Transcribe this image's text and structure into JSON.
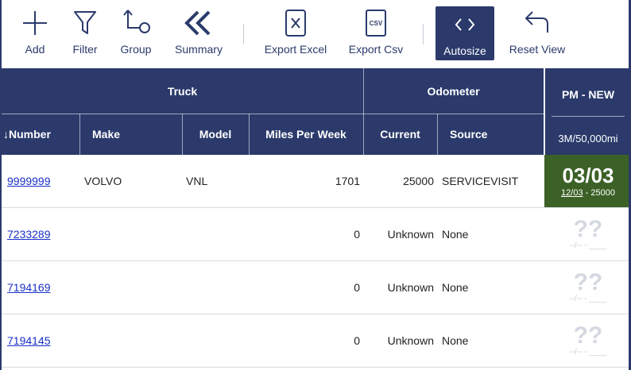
{
  "toolbar": {
    "add": "Add",
    "filter": "Filter",
    "group": "Group",
    "summary": "Summary",
    "export_excel": "Export Excel",
    "export_csv": "Export Csv",
    "export_csv_icon_text": "CSV",
    "autosize": "Autosize",
    "reset_view": "Reset View"
  },
  "headers": {
    "group_truck": "Truck",
    "group_odometer": "Odometer",
    "group_pm": "PM - NEW",
    "pm_sub": "3M/50,000mi",
    "number": "↓Number",
    "make": "Make",
    "model": "Model",
    "miles_per_week": "Miles Per Week",
    "current": "Current",
    "source": "Source"
  },
  "rows": [
    {
      "number": "9999999",
      "make": "VOLVO",
      "model": "VNL",
      "miles_per_week": "1701",
      "current": "25000",
      "source": "SERVICEVISIT",
      "pm_big": "03/03",
      "pm_date": "12/03",
      "pm_sep": " - ",
      "pm_miles": "25000"
    },
    {
      "number": "7233289",
      "make": "",
      "model": "",
      "miles_per_week": "0",
      "current": "Unknown",
      "source": "None",
      "pm_big": "??",
      "pm_small": "--/-- - ____"
    },
    {
      "number": "7194169",
      "make": "",
      "model": "",
      "miles_per_week": "0",
      "current": "Unknown",
      "source": "None",
      "pm_big": "??",
      "pm_small": "--/-- - ____"
    },
    {
      "number": "7194145",
      "make": "",
      "model": "",
      "miles_per_week": "0",
      "current": "Unknown",
      "source": "None",
      "pm_big": "??",
      "pm_small": "--/-- - ____"
    }
  ],
  "colors": {
    "header": "#2b3a6b",
    "pm_ok": "#3c6127",
    "link": "#1a2fc7"
  }
}
